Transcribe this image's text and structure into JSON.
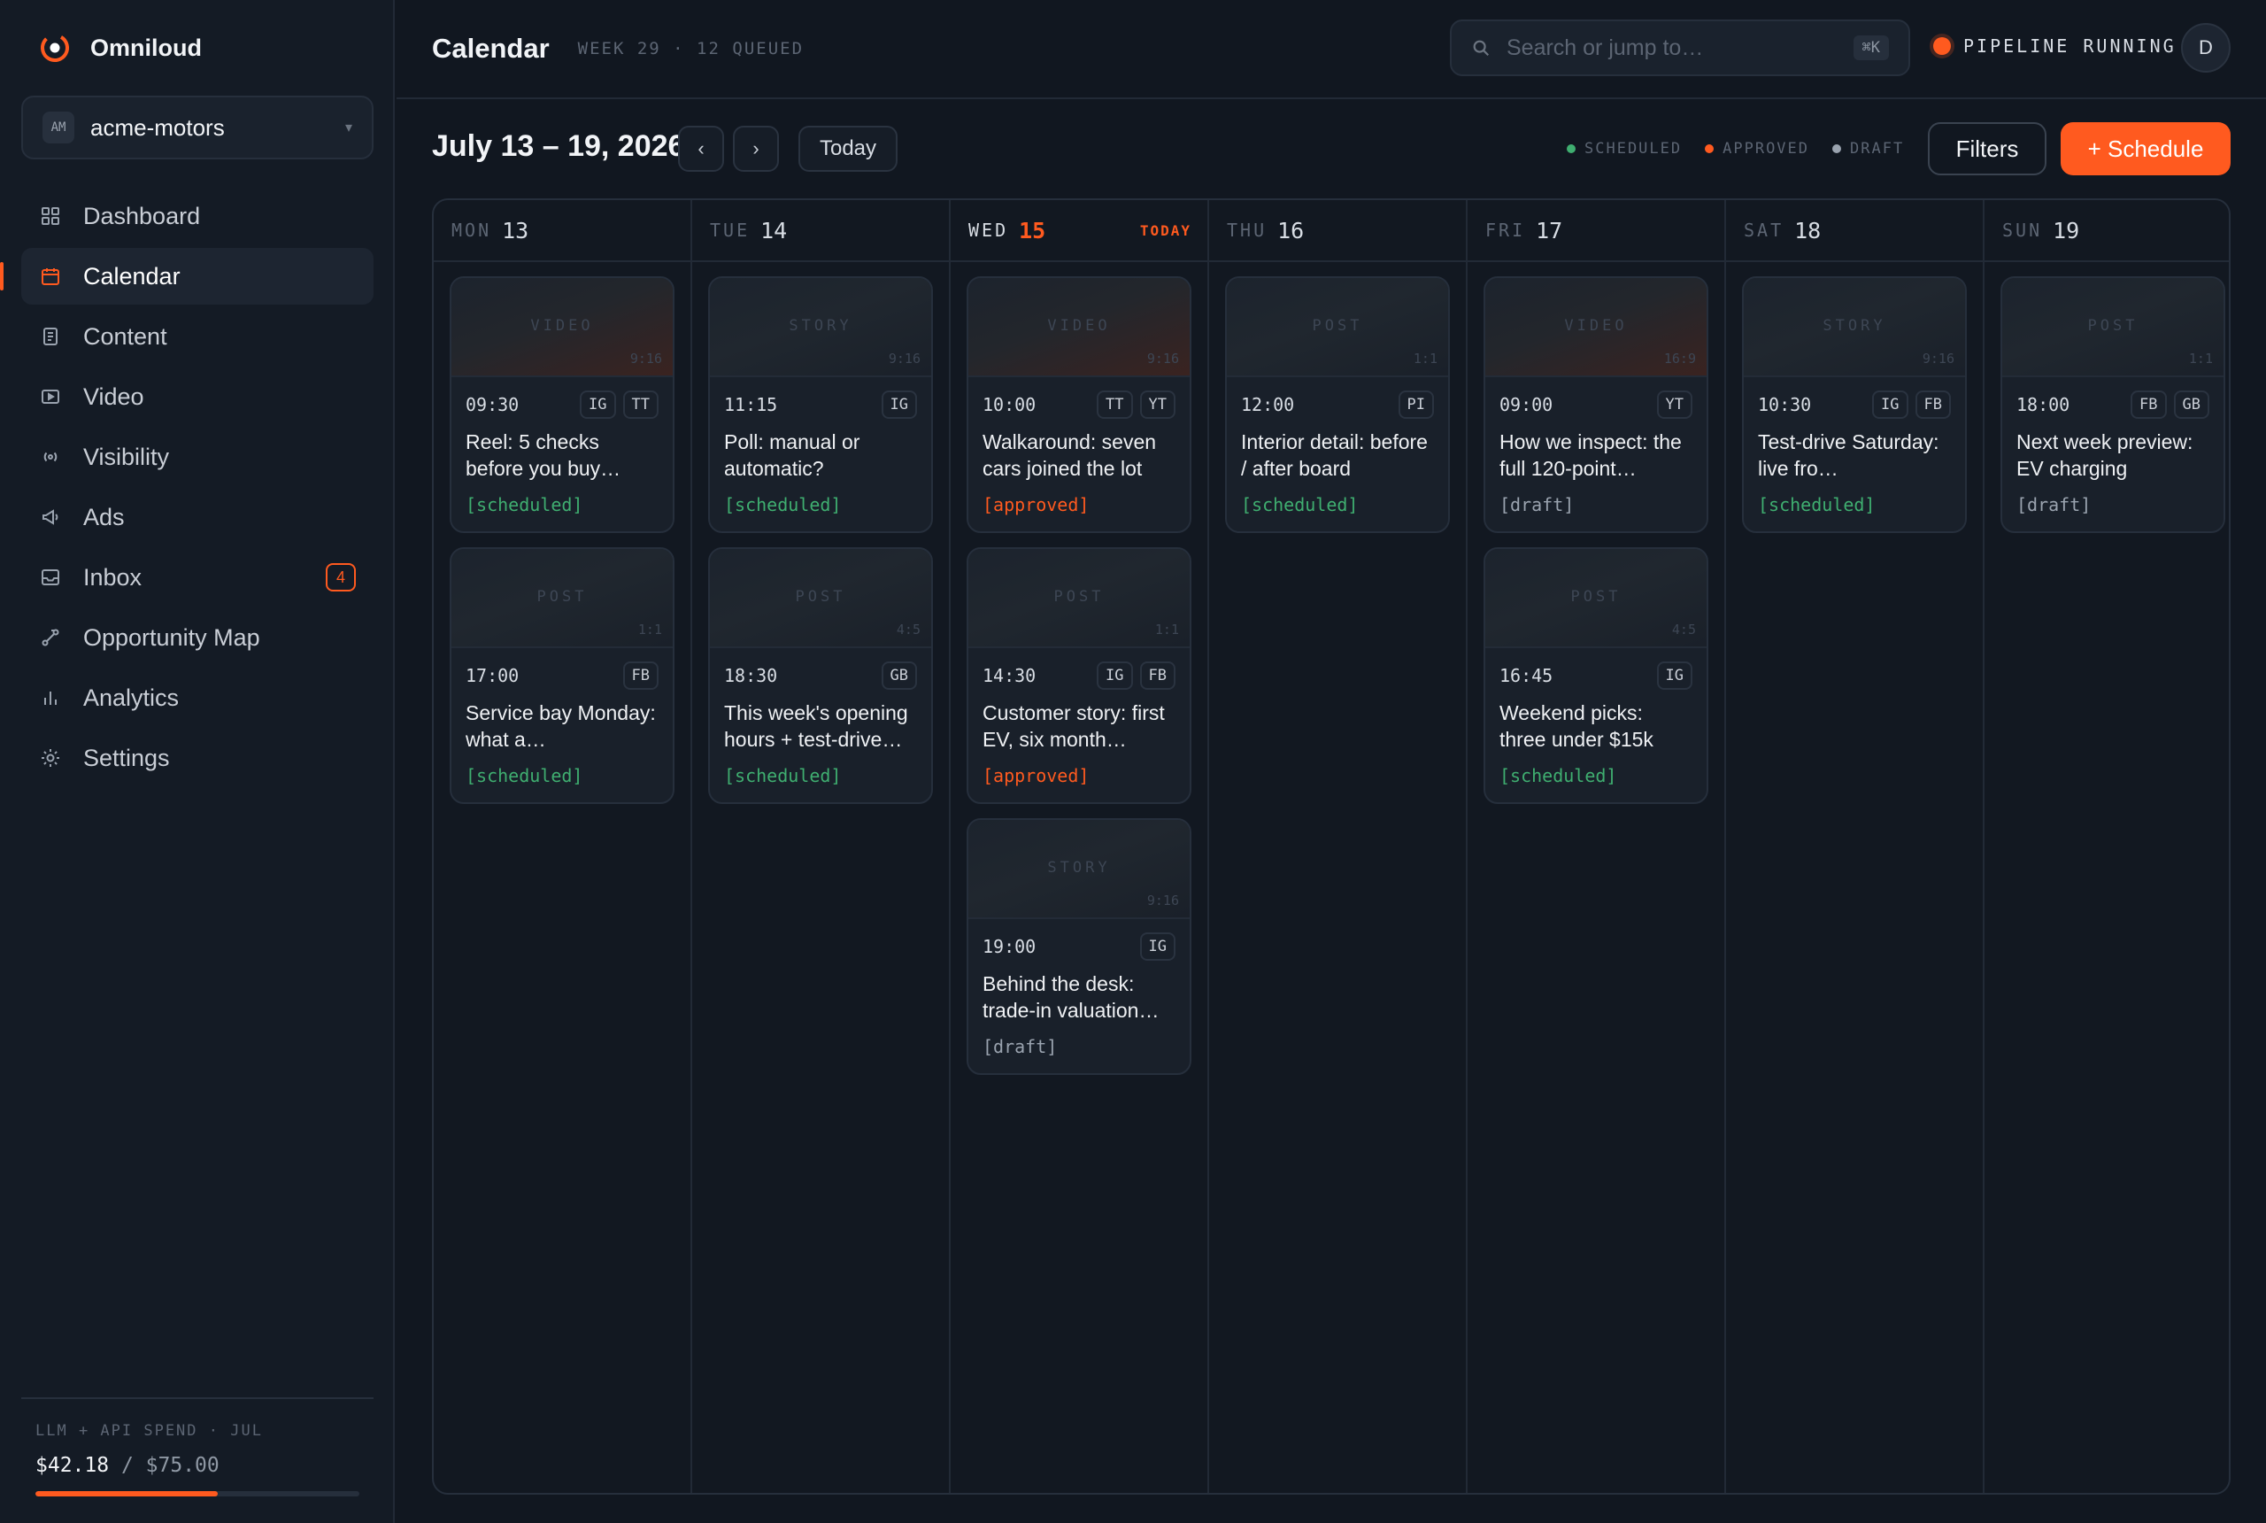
{
  "app": {
    "name": "Omniloud"
  },
  "workspace": {
    "initials": "AM",
    "name": "acme-motors"
  },
  "nav": [
    {
      "key": "dashboard",
      "label": "Dashboard",
      "icon": "grid-icon"
    },
    {
      "key": "calendar",
      "label": "Calendar",
      "icon": "calendar-icon",
      "active": true
    },
    {
      "key": "content",
      "label": "Content",
      "icon": "document-icon"
    },
    {
      "key": "video",
      "label": "Video",
      "icon": "play-icon"
    },
    {
      "key": "visibility",
      "label": "Visibility",
      "icon": "broadcast-icon"
    },
    {
      "key": "ads",
      "label": "Ads",
      "icon": "megaphone-icon"
    },
    {
      "key": "inbox",
      "label": "Inbox",
      "icon": "inbox-icon",
      "badge": "4"
    },
    {
      "key": "opportunity-map",
      "label": "Opportunity Map",
      "icon": "route-icon"
    },
    {
      "key": "analytics",
      "label": "Analytics",
      "icon": "bar-chart-icon"
    },
    {
      "key": "settings",
      "label": "Settings",
      "icon": "gear-icon"
    }
  ],
  "spend": {
    "label": "LLM + API SPEND · JUL",
    "current": "$42.18",
    "limit": "$75.00",
    "fraction": 0.5624
  },
  "header": {
    "title": "Calendar",
    "subtitle": "WEEK 29 · 12 QUEUED",
    "search_placeholder": "Search or jump to…",
    "shortcut": "⌘K",
    "pipeline": "PIPELINE RUNNING",
    "avatar": "D"
  },
  "toolbar": {
    "range": "July 13 – 19, 2026",
    "prev": "‹",
    "next": "›",
    "today": "Today",
    "legend": [
      {
        "label": "SCHEDULED",
        "color": "#3fae70"
      },
      {
        "label": "APPROVED",
        "color": "#ff5a1f"
      },
      {
        "label": "DRAFT",
        "color": "#9aa3af"
      }
    ],
    "filters": "Filters",
    "schedule": "+ Schedule"
  },
  "days": [
    {
      "name": "MON",
      "num": "13",
      "cards": [
        {
          "type": "VIDEO",
          "ratio": "9:16",
          "warm": true,
          "time": "09:30",
          "platforms": [
            "IG",
            "TT"
          ],
          "title": "Reel: 5 checks before you buy…",
          "status": "[scheduled]",
          "status_key": "scheduled"
        },
        {
          "type": "POST",
          "ratio": "1:1",
          "time": "17:00",
          "platforms": [
            "FB"
          ],
          "title": "Service bay Monday: what a…",
          "status": "[scheduled]",
          "status_key": "scheduled"
        }
      ]
    },
    {
      "name": "TUE",
      "num": "14",
      "cards": [
        {
          "type": "STORY",
          "ratio": "9:16",
          "time": "11:15",
          "platforms": [
            "IG"
          ],
          "title": "Poll: manual or automatic?",
          "status": "[scheduled]",
          "status_key": "scheduled"
        },
        {
          "type": "POST",
          "ratio": "4:5",
          "time": "18:30",
          "platforms": [
            "GB"
          ],
          "title": "This week's opening hours + test-drive…",
          "status": "[scheduled]",
          "status_key": "scheduled"
        }
      ]
    },
    {
      "name": "WED",
      "num": "15",
      "today": true,
      "today_label": "TODAY",
      "cards": [
        {
          "type": "VIDEO",
          "ratio": "9:16",
          "warm": true,
          "time": "10:00",
          "platforms": [
            "TT",
            "YT"
          ],
          "title": "Walkaround: seven cars joined the lot",
          "status": "[approved]",
          "status_key": "approved"
        },
        {
          "type": "POST",
          "ratio": "1:1",
          "time": "14:30",
          "platforms": [
            "IG",
            "FB"
          ],
          "title": "Customer story: first EV, six month…",
          "status": "[approved]",
          "status_key": "approved"
        },
        {
          "type": "STORY",
          "ratio": "9:16",
          "time": "19:00",
          "platforms": [
            "IG"
          ],
          "title": "Behind the desk: trade-in valuation…",
          "status": "[draft]",
          "status_key": "draft"
        }
      ]
    },
    {
      "name": "THU",
      "num": "16",
      "cards": [
        {
          "type": "POST",
          "ratio": "1:1",
          "time": "12:00",
          "platforms": [
            "PI"
          ],
          "title": "Interior detail: before / after board",
          "status": "[scheduled]",
          "status_key": "scheduled"
        }
      ]
    },
    {
      "name": "FRI",
      "num": "17",
      "cards": [
        {
          "type": "VIDEO",
          "ratio": "16:9",
          "warm": true,
          "time": "09:00",
          "platforms": [
            "YT"
          ],
          "title": "How we inspect: the full 120-point…",
          "status": "[draft]",
          "status_key": "draft"
        },
        {
          "type": "POST",
          "ratio": "4:5",
          "time": "16:45",
          "platforms": [
            "IG"
          ],
          "title": "Weekend picks: three under $15k",
          "status": "[scheduled]",
          "status_key": "scheduled"
        }
      ]
    },
    {
      "name": "SAT",
      "num": "18",
      "cards": [
        {
          "type": "STORY",
          "ratio": "9:16",
          "time": "10:30",
          "platforms": [
            "IG",
            "FB"
          ],
          "title": "Test-drive Saturday: live fro…",
          "status": "[scheduled]",
          "status_key": "scheduled"
        }
      ]
    },
    {
      "name": "SUN",
      "num": "19",
      "cards": [
        {
          "type": "POST",
          "ratio": "1:1",
          "time": "18:00",
          "platforms": [
            "FB",
            "GB"
          ],
          "title": "Next week preview: EV charging basics…",
          "status": "[draft]",
          "status_key": "draft"
        }
      ]
    }
  ]
}
